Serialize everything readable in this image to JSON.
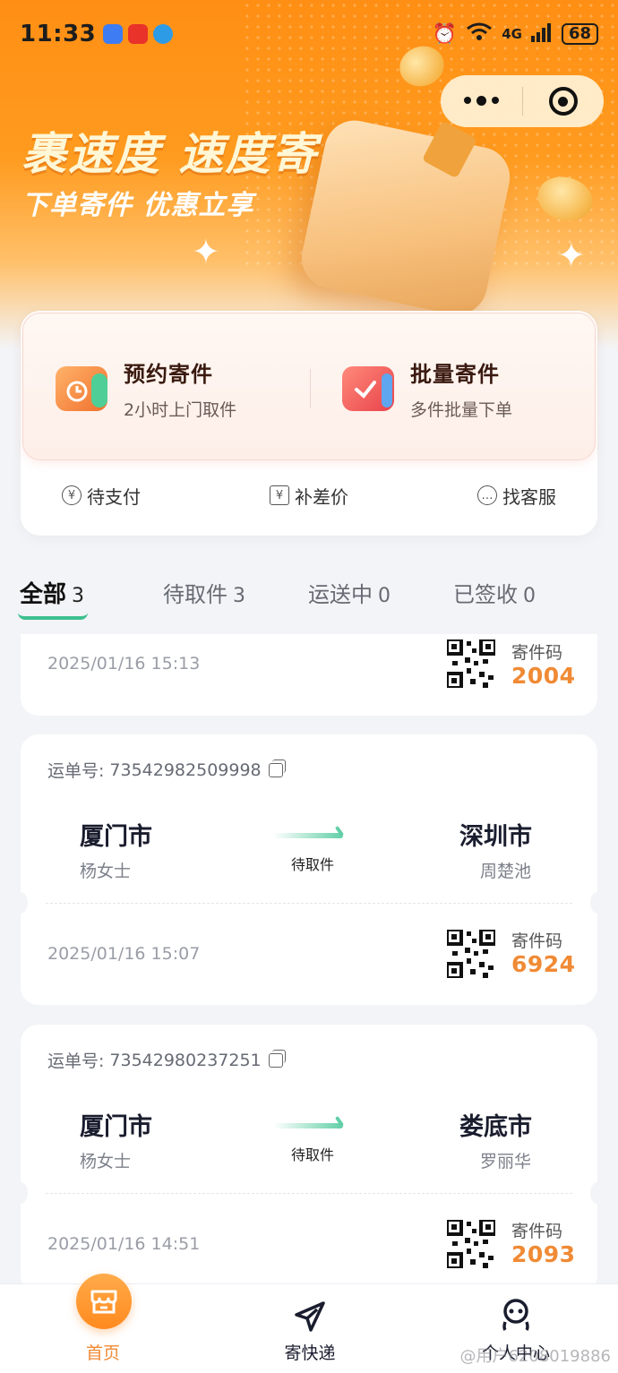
{
  "status_bar": {
    "time": "11:33",
    "network": "4G",
    "battery": "68"
  },
  "banner": {
    "slogan_main": "裹速度 速度寄",
    "slogan_sub": "下单寄件 优惠立享"
  },
  "quick_actions": [
    {
      "title": "预约寄件",
      "subtitle": "2小时上门取件",
      "icon": "calendar-icon"
    },
    {
      "title": "批量寄件",
      "subtitle": "多件批量下单",
      "icon": "batch-package-icon"
    }
  ],
  "quick_links": [
    {
      "label": "待支付",
      "icon": "yuan-icon"
    },
    {
      "label": "补差价",
      "icon": "price-tag-icon"
    },
    {
      "label": "找客服",
      "icon": "chat-icon"
    }
  ],
  "tabs": [
    {
      "label": "全部",
      "count": "3"
    },
    {
      "label": "待取件",
      "count": "3"
    },
    {
      "label": "运送中",
      "count": "0"
    },
    {
      "label": "已签收",
      "count": "0"
    }
  ],
  "orders": [
    {
      "waybill_label": "运单号:",
      "waybill_no": "",
      "from_city": "",
      "from_name": "",
      "to_city": "",
      "to_name": "",
      "status": "",
      "date": "2025/01/16 15:13",
      "code_label": "寄件码",
      "code": "2004"
    },
    {
      "waybill_label": "运单号:",
      "waybill_no": "73542982509998",
      "from_city": "厦门市",
      "from_name": "杨女士",
      "to_city": "深圳市",
      "to_name": "周楚池",
      "status": "待取件",
      "date": "2025/01/16 15:07",
      "code_label": "寄件码",
      "code": "6924"
    },
    {
      "waybill_label": "运单号:",
      "waybill_no": "73542980237251",
      "from_city": "厦门市",
      "from_name": "杨女士",
      "to_city": "娄底市",
      "to_name": "罗丽华",
      "status": "待取件",
      "date": "2025/01/16 14:51",
      "code_label": "寄件码",
      "code": "2093"
    }
  ],
  "bottom_nav": [
    {
      "label": "首页",
      "icon": "home-shop-icon",
      "active": true
    },
    {
      "label": "寄快递",
      "icon": "send-paper-plane-icon",
      "active": false
    },
    {
      "label": "个人中心",
      "icon": "user-icon",
      "active": false
    }
  ],
  "watermark": "@用户6208019886",
  "colors": {
    "brand_orange": "#ff8f14",
    "code_orange": "#f08a35",
    "accent_green": "#3ec08e"
  }
}
